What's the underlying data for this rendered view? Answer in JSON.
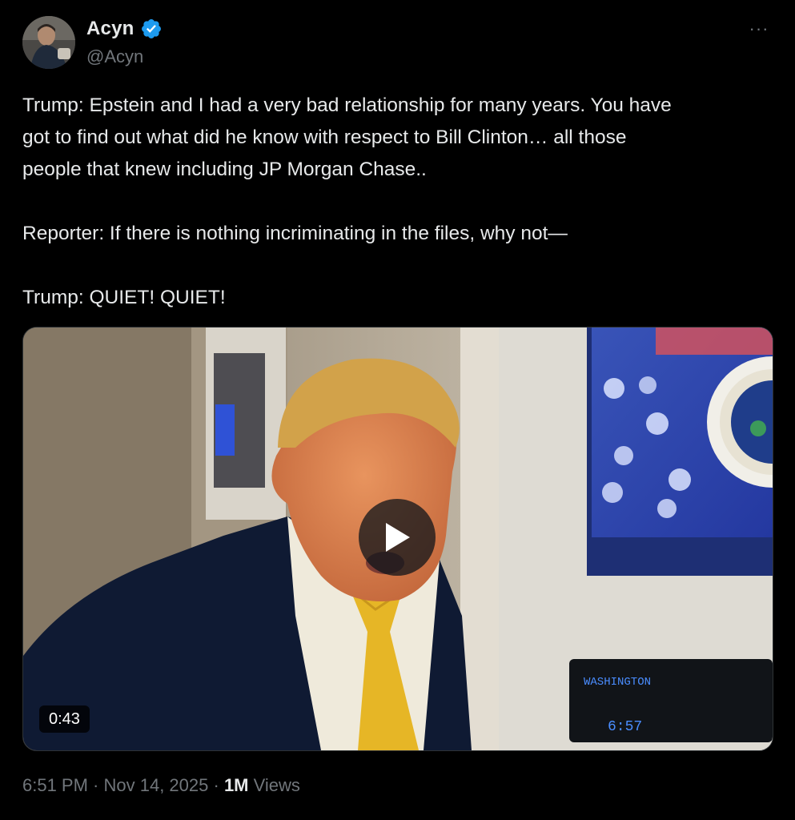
{
  "author": {
    "display_name": "Acyn",
    "handle": "@Acyn",
    "verified": true
  },
  "icons": {
    "verified": "verified-badge-icon",
    "more": "more-dots-icon",
    "play": "play-icon"
  },
  "more_label": "···",
  "tweet": {
    "paragraphs": [
      "Trump: Epstein and I had a very bad relationship for many years. You have\ngot to find out what did he know with respect to Bill Clinton… all those\npeople that knew including JP Morgan Chase..",
      "Reporter: If there is nothing incriminating in the files, why not—",
      "Trump: QUIET! QUIET!"
    ]
  },
  "media": {
    "duration": "0:43",
    "sign_text": "WASHINGTON",
    "clock_text": "6:57"
  },
  "meta": {
    "time": "6:51 PM",
    "date": "Nov 14, 2025",
    "separator": " · ",
    "views_count": "1M",
    "views_label": "Views"
  },
  "colors": {
    "background": "#000000",
    "text": "#e7e9ea",
    "secondary": "#71767b",
    "verified": "#1d9bf0"
  }
}
